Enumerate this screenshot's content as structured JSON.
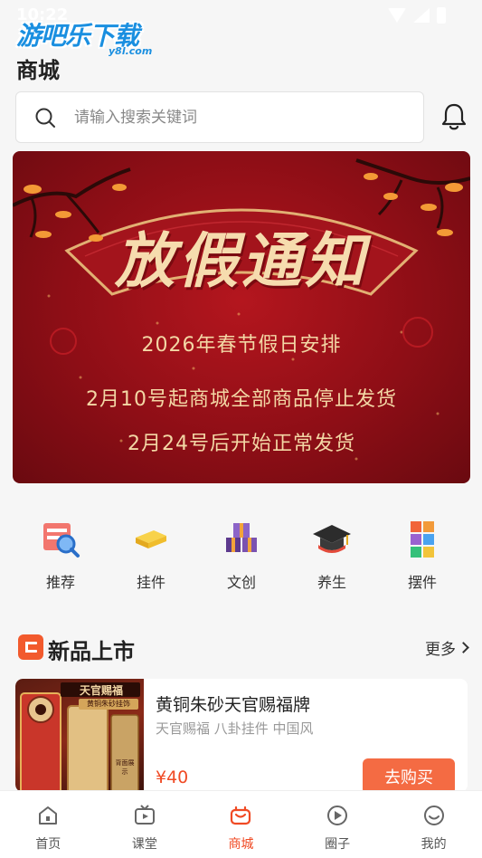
{
  "status_bar": {
    "time": "10:22"
  },
  "watermark": {
    "text": "游吧乐下载",
    "sub": "y8l.com"
  },
  "header": {
    "title": "商城"
  },
  "search": {
    "placeholder": "请输入搜索关键词"
  },
  "banner": {
    "title": "放假通知",
    "line1": "2026年春节假日安排",
    "line2": "2月10号起商城全部商品停止发货",
    "line3": "2月24号后开始正常发货"
  },
  "categories": [
    {
      "label": "推荐",
      "icon": "recommend-icon"
    },
    {
      "label": "挂件",
      "icon": "pendant-icon"
    },
    {
      "label": "文创",
      "icon": "cultural-icon"
    },
    {
      "label": "养生",
      "icon": "wellness-icon"
    },
    {
      "label": "摆件",
      "icon": "ornament-icon"
    }
  ],
  "section": {
    "title": "新品上市",
    "more": "更多"
  },
  "product": {
    "name": "黄铜朱砂天官赐福牌",
    "tags": "天官赐福 八卦挂件 中国风",
    "price": "¥40",
    "buy_label": "去购买",
    "image_text_top": "天官赐福",
    "image_text_sub": "黄铜朱砂挂饰",
    "image_text_back": "背面展示"
  },
  "tabs": [
    {
      "label": "首页",
      "icon": "home-icon",
      "active": false
    },
    {
      "label": "课堂",
      "icon": "classroom-icon",
      "active": false
    },
    {
      "label": "商城",
      "icon": "shop-icon",
      "active": true
    },
    {
      "label": "圈子",
      "icon": "circle-icon",
      "active": false
    },
    {
      "label": "我的",
      "icon": "profile-icon",
      "active": false
    }
  ],
  "colors": {
    "accent": "#f04a24",
    "banner_red": "#9a1018",
    "gold": "#f3d7a5"
  }
}
